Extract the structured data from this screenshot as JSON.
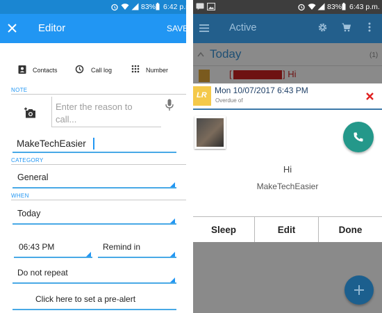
{
  "left": {
    "status": {
      "battery": "83%",
      "time": "6:42 p.m."
    },
    "appbar": {
      "title": "Editor",
      "save_label": "SAVE"
    },
    "import": [
      {
        "label": "Contacts",
        "icon": "contacts-icon"
      },
      {
        "label": "Call log",
        "icon": "call-log-icon"
      },
      {
        "label": "Number",
        "icon": "dialpad-icon"
      }
    ],
    "note": {
      "section_label": "NOTE",
      "placeholder": "Enter the reason to call...",
      "value": "MakeTechEasier"
    },
    "category": {
      "section_label": "CATEGORY",
      "value": "General"
    },
    "when": {
      "section_label": "WHEN",
      "date": "Today",
      "time": "06:43 PM",
      "remind": "Remind in",
      "repeat": "Do not repeat",
      "prealert": "Click here to set a pre-alert"
    }
  },
  "right": {
    "status": {
      "battery": "83%",
      "time": "6:43 p.m."
    },
    "appbar": {
      "title": "Active"
    },
    "list": {
      "section": "Today",
      "count": "(1)",
      "preview_suffix": "] Hi"
    },
    "alert": {
      "datetime": "Mon 10/07/2017 6:43 PM",
      "status": "Overdue of",
      "message": "Hi",
      "contact": "MakeTechEasier",
      "buttons": {
        "sleep": "Sleep",
        "edit": "Edit",
        "done": "Done"
      },
      "app_icon_text": "LR"
    }
  },
  "colors": {
    "primary": "#2196f3",
    "primary_dark": "#1a86d2",
    "dim_appbar": "#235f8c",
    "teal_button": "#24988a",
    "close_red": "#e02020",
    "alert_header_yellow": "#f4c94a"
  }
}
